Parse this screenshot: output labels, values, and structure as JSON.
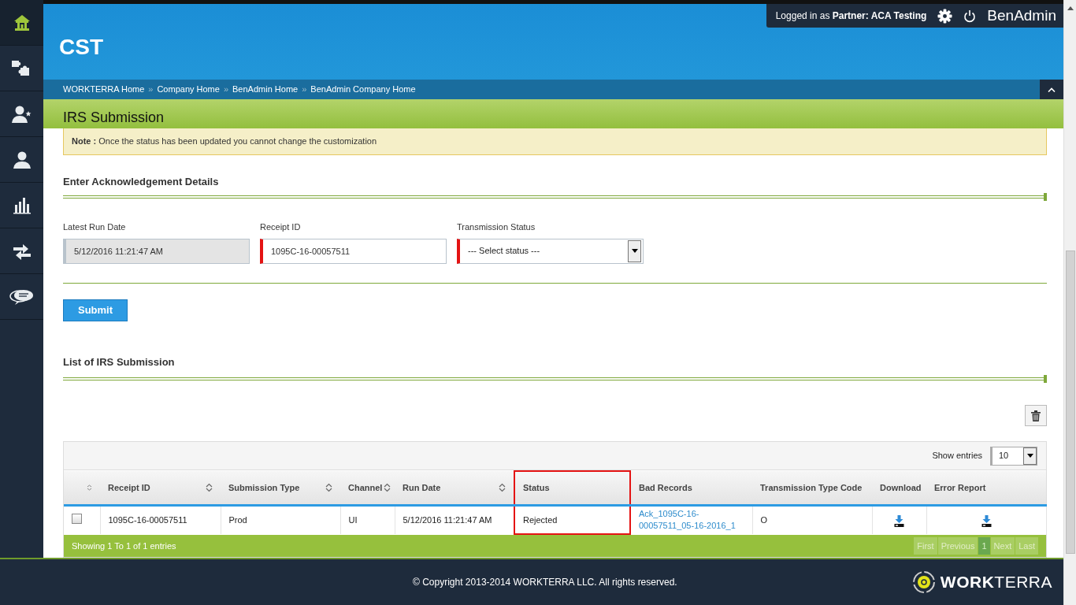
{
  "sidebar": {
    "items": [
      {
        "selected": true
      },
      {
        "selected": false
      },
      {
        "selected": false
      },
      {
        "selected": false
      },
      {
        "selected": false
      },
      {
        "selected": false
      },
      {
        "selected": false
      }
    ]
  },
  "header": {
    "title": "CST",
    "user_text": "Logged in as **Partner:  ACA Testing**",
    "app_name": "BenAdmin"
  },
  "breadcrumbs": {
    "separator": "»",
    "items": [
      "WORKTERRA Home",
      "Company Home",
      "BenAdmin Home",
      "BenAdmin Company Home"
    ]
  },
  "page_title": "IRS Submission",
  "note": "**Note :** Once the status has been updated you cannot change the customization",
  "acknowledgement": {
    "heading": "Enter Acknowledgement Details",
    "submit": "Submit",
    "fields": [
      {
        "kind": "text",
        "label": "Latest Run Date",
        "value": "5/12/2016 11:21:47 AM",
        "disabled": true,
        "required": false
      },
      {
        "kind": "text",
        "label": "Receipt ID",
        "value": "1095C-16-00057511",
        "disabled": false,
        "required": true
      },
      {
        "kind": "select",
        "label": "Transmission Status",
        "value": "--- Select status ---",
        "disabled": false,
        "required": true
      }
    ]
  },
  "list": {
    "heading": "List of IRS Submission",
    "show_entries": {
      "label": "Show entries",
      "value": "10"
    },
    "columns": [
      {
        "kind": "check",
        "sortable": true,
        "highlighted": false
      },
      {
        "kind": "text",
        "label": "Receipt ID",
        "sortable": true,
        "highlighted": false
      },
      {
        "kind": "text",
        "label": "Submission Type",
        "sortable": true,
        "highlighted": false
      },
      {
        "kind": "text",
        "label": "Channel",
        "sortable": true,
        "highlighted": false
      },
      {
        "kind": "text",
        "label": "Run Date",
        "sortable": true,
        "highlighted": false
      },
      {
        "kind": "text",
        "label": "Status",
        "sortable": false,
        "highlighted": true
      },
      {
        "kind": "text",
        "label": "Bad Records",
        "sortable": false,
        "highlighted": false
      },
      {
        "kind": "text",
        "label": "Transmission Type Code",
        "sortable": false,
        "highlighted": false
      },
      {
        "kind": "text",
        "label": "Download",
        "sortable": false,
        "highlighted": false
      },
      {
        "kind": "text",
        "label": "Error Report",
        "sortable": false,
        "highlighted": false
      }
    ],
    "rows": [
      {
        "checked": false,
        "cells": [
          {
            "kind": "check"
          },
          {
            "kind": "text",
            "text": "1095C-16-00057511"
          },
          {
            "kind": "text",
            "text": "Prod"
          },
          {
            "kind": "text",
            "text": "UI"
          },
          {
            "kind": "text",
            "text": "5/12/2016 11:21:47 AM"
          },
          {
            "kind": "text",
            "text": "Rejected"
          },
          {
            "kind": "link",
            "text": "Ack_1095C-16-00057511_05-16-2016_1"
          },
          {
            "kind": "text",
            "text": "O"
          },
          {
            "kind": "download"
          },
          {
            "kind": "download"
          }
        ]
      }
    ],
    "info": "Showing 1 To 1 of 1 entries",
    "pages": [
      {
        "label": "First",
        "selected": false,
        "disabled": true
      },
      {
        "label": "Previous",
        "selected": false,
        "disabled": true
      },
      {
        "label": "1",
        "selected": true,
        "disabled": false
      },
      {
        "label": "Next",
        "selected": false,
        "disabled": true
      },
      {
        "label": "Last",
        "selected": false,
        "disabled": true
      }
    ]
  },
  "footer": {
    "copyright": "© Copyright 2013-2014 WORKTERRA LLC. All rights reserved.",
    "logo": "**WORK**TERRA"
  }
}
